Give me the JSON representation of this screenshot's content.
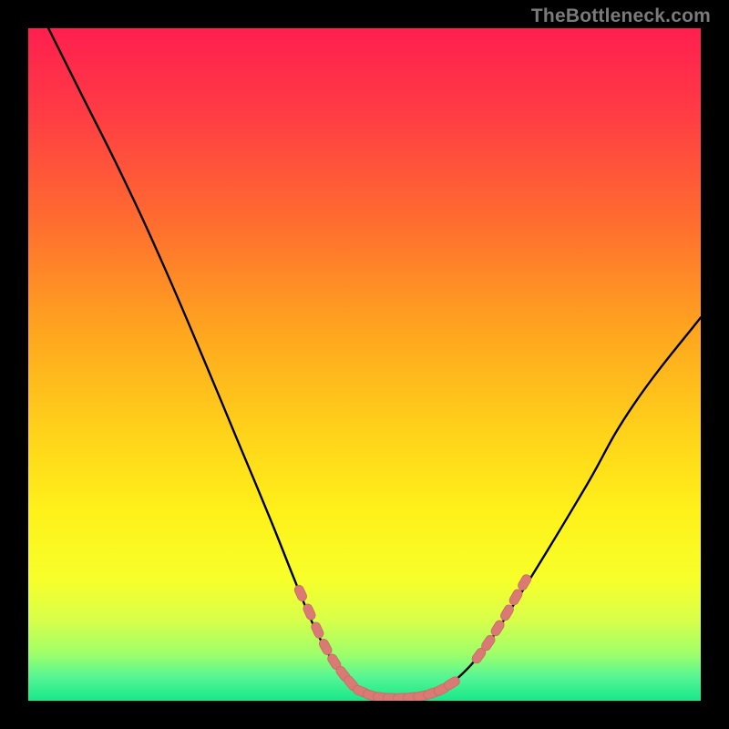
{
  "watermark": {
    "text": "TheBottleneck.com"
  },
  "colors": {
    "black": "#000000",
    "curve": "#000000",
    "marker_fill": "#d97a74",
    "marker_stroke": "#c96a64",
    "gradient_stops": [
      {
        "offset": 0.0,
        "color": "#ff1f4f"
      },
      {
        "offset": 0.12,
        "color": "#ff3a45"
      },
      {
        "offset": 0.28,
        "color": "#ff6a30"
      },
      {
        "offset": 0.45,
        "color": "#ffa51f"
      },
      {
        "offset": 0.6,
        "color": "#ffd21a"
      },
      {
        "offset": 0.72,
        "color": "#fff11a"
      },
      {
        "offset": 0.82,
        "color": "#f7ff2a"
      },
      {
        "offset": 0.88,
        "color": "#d8ff4a"
      },
      {
        "offset": 0.93,
        "color": "#9fff6a"
      },
      {
        "offset": 0.965,
        "color": "#55f594"
      },
      {
        "offset": 1.0,
        "color": "#17e88a"
      }
    ]
  },
  "chart_data": {
    "type": "line",
    "title": "",
    "xlabel": "",
    "ylabel": "",
    "xlim": [
      0,
      100
    ],
    "ylim": [
      0,
      100
    ],
    "curve": [
      {
        "x": 3.0,
        "y": 100.0
      },
      {
        "x": 8.0,
        "y": 90.0
      },
      {
        "x": 14.0,
        "y": 78.0
      },
      {
        "x": 20.0,
        "y": 65.0
      },
      {
        "x": 26.0,
        "y": 51.0
      },
      {
        "x": 31.0,
        "y": 39.0
      },
      {
        "x": 36.0,
        "y": 27.0
      },
      {
        "x": 40.0,
        "y": 17.0
      },
      {
        "x": 43.0,
        "y": 10.0
      },
      {
        "x": 46.0,
        "y": 5.0
      },
      {
        "x": 49.0,
        "y": 2.0
      },
      {
        "x": 52.0,
        "y": 0.6
      },
      {
        "x": 55.0,
        "y": 0.4
      },
      {
        "x": 58.0,
        "y": 0.6
      },
      {
        "x": 61.0,
        "y": 1.5
      },
      {
        "x": 64.0,
        "y": 3.5
      },
      {
        "x": 68.0,
        "y": 8.0
      },
      {
        "x": 72.0,
        "y": 14.0
      },
      {
        "x": 77.0,
        "y": 22.0
      },
      {
        "x": 83.0,
        "y": 32.0
      },
      {
        "x": 90.0,
        "y": 44.0
      },
      {
        "x": 100.0,
        "y": 57.0
      }
    ],
    "markers_left": [
      {
        "x": 40.5,
        "y": 16.0
      },
      {
        "x": 41.8,
        "y": 13.2
      },
      {
        "x": 43.0,
        "y": 10.5
      },
      {
        "x": 44.2,
        "y": 8.0
      },
      {
        "x": 45.5,
        "y": 5.8
      },
      {
        "x": 46.8,
        "y": 4.0
      },
      {
        "x": 48.0,
        "y": 2.6
      }
    ],
    "markers_bottom": [
      {
        "x": 49.5,
        "y": 1.4
      },
      {
        "x": 51.0,
        "y": 0.8
      },
      {
        "x": 52.5,
        "y": 0.5
      },
      {
        "x": 54.0,
        "y": 0.4
      },
      {
        "x": 55.5,
        "y": 0.4
      },
      {
        "x": 57.0,
        "y": 0.5
      },
      {
        "x": 58.5,
        "y": 0.7
      },
      {
        "x": 60.0,
        "y": 1.1
      },
      {
        "x": 61.5,
        "y": 1.7
      },
      {
        "x": 63.0,
        "y": 2.6
      }
    ],
    "markers_right": [
      {
        "x": 67.0,
        "y": 6.7
      },
      {
        "x": 68.4,
        "y": 8.6
      },
      {
        "x": 69.8,
        "y": 10.8
      },
      {
        "x": 71.2,
        "y": 13.1
      },
      {
        "x": 72.5,
        "y": 15.4
      },
      {
        "x": 73.8,
        "y": 17.6
      }
    ]
  }
}
